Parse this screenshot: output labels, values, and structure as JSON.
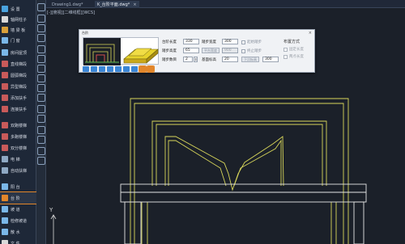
{
  "sidebar": {
    "items": [
      {
        "label": "设    置",
        "icon_color": "#4aa3df"
      },
      {
        "label": "轴网柱子",
        "icon_color": "#d9d9d9"
      },
      {
        "label": "墙    梁 板",
        "icon_color": "#d9a03a"
      },
      {
        "label": "门    窗",
        "icon_color": "#7ab7e8"
      },
      {
        "label": "房间屋顶",
        "icon_color": "#7ab7e8"
      },
      {
        "label": "直线梯段",
        "icon_color": "#c85a5a"
      },
      {
        "label": "圆弧梯段",
        "icon_color": "#c85a5a"
      },
      {
        "label": "异型梯段",
        "icon_color": "#c85a5a"
      },
      {
        "label": "添加扶手",
        "icon_color": "#c85a5a"
      },
      {
        "label": "连接扶手",
        "icon_color": "#c85a5a"
      },
      {
        "label": "双跑楼梯",
        "icon_color": "#c85a5a"
      },
      {
        "label": "多跑楼梯",
        "icon_color": "#c85a5a"
      },
      {
        "label": "双分楼梯",
        "icon_color": "#c85a5a"
      },
      {
        "label": "电    梯",
        "icon_color": "#8fa9c4"
      },
      {
        "label": "自动扶梯",
        "icon_color": "#8fa9c4"
      },
      {
        "label": "阳    台",
        "icon_color": "#7ab7e8"
      },
      {
        "label": "台    阶",
        "icon_color": "#e2862a",
        "active": true
      },
      {
        "label": "坡    道",
        "icon_color": "#7ab7e8"
      },
      {
        "label": "检修坡道",
        "icon_color": "#7ab7e8"
      },
      {
        "label": "散    水",
        "icon_color": "#7ab7e8"
      },
      {
        "label": "文    件",
        "icon_color": "#d9d9d9"
      }
    ]
  },
  "tabs": [
    {
      "label": "Drawing1.dwg*"
    },
    {
      "label": "K_台阶平面.dwg*",
      "active": true
    }
  ],
  "viewport_label": "[-][俯视][二维线框][WCS]",
  "dialog": {
    "title": "台阶",
    "close": "×",
    "fields": {
      "length_label": "台阶长度",
      "length_value": "330",
      "total_height_label": "踏步高度",
      "total_height_value": "65",
      "steps_label": "踏步数目",
      "steps_value": "2",
      "tread_width_label": "踏步宽度",
      "tread_width_value": "300",
      "platform_label": "平台宽度",
      "platform_value": "900",
      "base_label": "基面标高",
      "base_value": "20",
      "sink_label": "下沉标高",
      "sink_value": "300"
    },
    "checks": {
      "first_step": "起始踏步",
      "last_step": "终止踏步"
    },
    "options": {
      "title": "布置方式",
      "opt1": "固定长度",
      "opt2": "两点长度"
    }
  },
  "axis": {
    "y_label": "Y"
  }
}
